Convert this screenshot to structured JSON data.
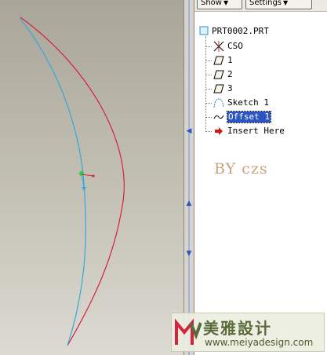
{
  "toolbar": {
    "show_label": "Show",
    "settings_label": "Settings"
  },
  "tree": {
    "root": "PRT0002.PRT",
    "items": [
      {
        "label": "CSO",
        "icon": "csys-icon"
      },
      {
        "label": "1",
        "icon": "datum-plane-icon"
      },
      {
        "label": "2",
        "icon": "datum-plane-icon"
      },
      {
        "label": "3",
        "icon": "datum-plane-icon"
      },
      {
        "label": "Sketch 1",
        "icon": "sketch-icon"
      },
      {
        "label": "Offset 1",
        "icon": "curve-icon",
        "selected": true
      },
      {
        "label": "Insert Here",
        "icon": "insert-arrow-icon"
      }
    ]
  },
  "watermark": "BY czs",
  "logo": {
    "cn": "美雅設计",
    "url": "www.meiyadesign.com"
  },
  "colors": {
    "viewport_top": "#a9a599",
    "viewport_bottom": "#dcdad2",
    "curve_offset": "#d8213a",
    "curve_sketch": "#35a6e0",
    "selection": "#2a55c0"
  }
}
